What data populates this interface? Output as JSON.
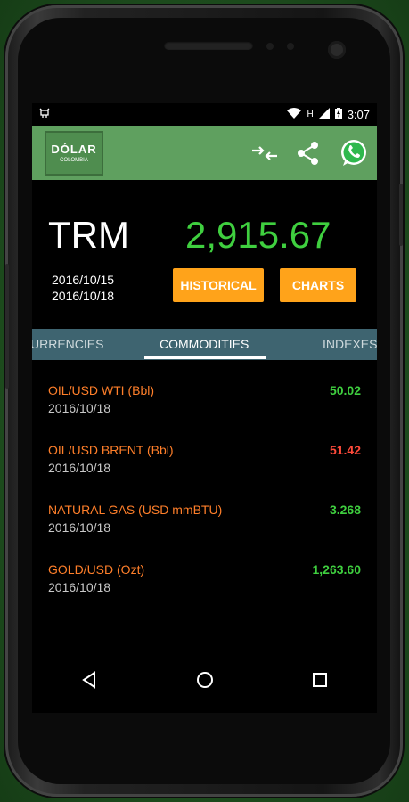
{
  "statusbar": {
    "time": "3:07",
    "network": "H"
  },
  "app": {
    "logo_title": "DÓLAR",
    "logo_subtitle": "COLOMBIA"
  },
  "trm": {
    "label": "TRM",
    "value": "2,915.67",
    "date_from": "2016/10/15",
    "date_to": "2016/10/18"
  },
  "buttons": {
    "historical": "HISTORICAL",
    "charts": "CHARTS"
  },
  "tabs": [
    {
      "label": "URRENCIES"
    },
    {
      "label": "COMMODITIES"
    },
    {
      "label": "INDEXES"
    }
  ],
  "items": [
    {
      "name": "OIL/USD WTI (Bbl)",
      "date": "2016/10/18",
      "value": "50.02",
      "color": "#3fcf3f"
    },
    {
      "name": "OIL/USD BRENT (Bbl)",
      "date": "2016/10/18",
      "value": "51.42",
      "color": "#ff4a3a"
    },
    {
      "name": "NATURAL GAS (USD mmBTU)",
      "date": "2016/10/18",
      "value": "3.268",
      "color": "#3fcf3f"
    },
    {
      "name": "GOLD/USD (Ozt)",
      "date": "2016/10/18",
      "value": "1,263.60",
      "color": "#3fcf3f"
    }
  ],
  "icons": {
    "compare": "compare-arrows-icon",
    "share": "share-icon",
    "whatsapp": "whatsapp-icon"
  },
  "colors": {
    "appbar": "#5fa05f",
    "accent_button": "#ffa31a",
    "trm_value": "#3fcf3f",
    "tab_bar": "#3e6470",
    "item_name": "#ff7f2a"
  }
}
